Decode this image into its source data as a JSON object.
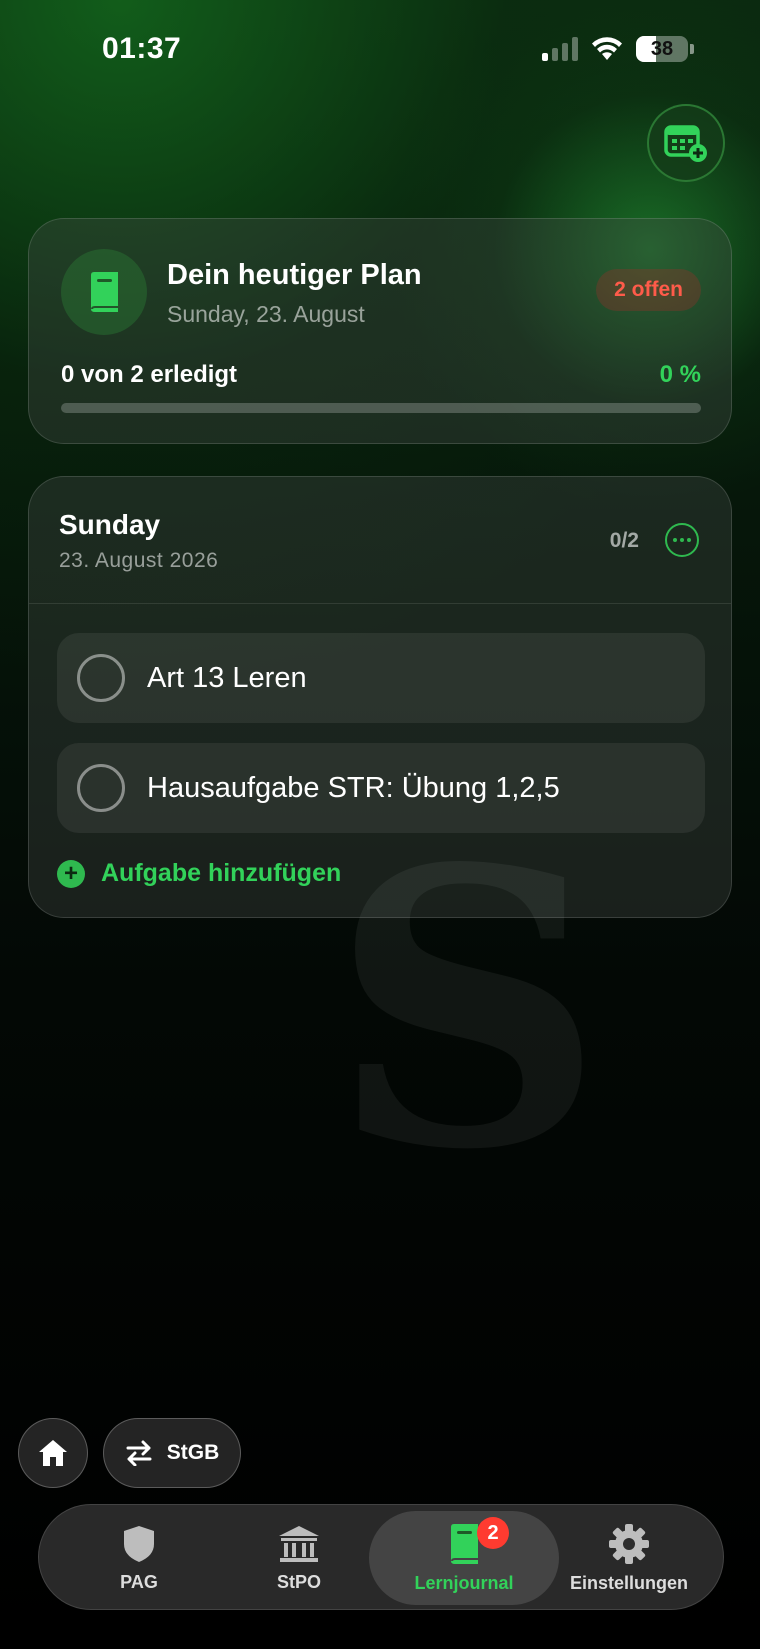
{
  "status_bar": {
    "time": "01:37",
    "battery": "38",
    "signal_bars_active": 1,
    "signal_bars_total": 4
  },
  "header": {
    "calendar_add_icon": "calendar-plus-icon"
  },
  "plan_card": {
    "icon": "book-icon",
    "title": "Dein heutiger Plan",
    "date": "Sunday, 23. August",
    "open_badge": "2 offen",
    "progress_text": "0 von 2 erledigt",
    "progress_percent_label": "0 %",
    "progress_value": 0
  },
  "day_card": {
    "title": "Sunday",
    "date": "23. August 2026",
    "count": "0/2",
    "tasks": [
      {
        "label": "Art 13 Leren",
        "done": false
      },
      {
        "label": "Hausaufgabe STR: Übung 1,2,5",
        "done": false
      }
    ],
    "add_task_label": "Aufgabe hinzufügen"
  },
  "watermark": "S",
  "quick_actions": {
    "home_icon": "home-icon",
    "law_switch_icon": "swap-arrows-icon",
    "law_label": "StGB"
  },
  "tabbar": {
    "tabs": [
      {
        "label": "PAG",
        "icon": "shield-icon",
        "active": false
      },
      {
        "label": "StPO",
        "icon": "courthouse-icon",
        "active": false
      },
      {
        "label": "Lernjournal",
        "icon": "book-icon",
        "active": true,
        "badge": "2"
      },
      {
        "label": "Einstellungen",
        "icon": "gear-icon",
        "active": false
      }
    ]
  },
  "colors": {
    "accent_green": "#32d25a",
    "badge_red": "#ff3b30",
    "open_red": "#ff5b4a"
  }
}
